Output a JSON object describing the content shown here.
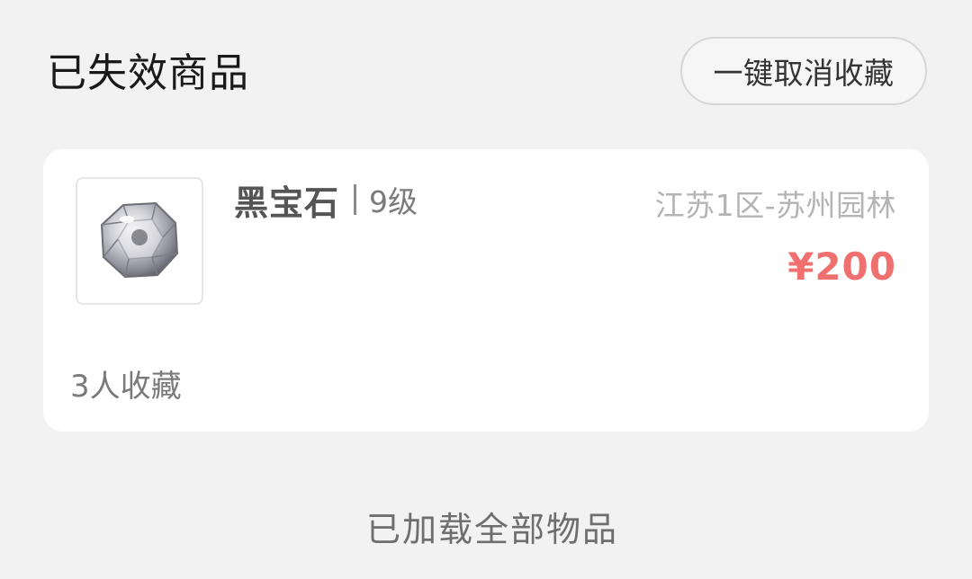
{
  "header": {
    "title": "已失效商品",
    "cancel_all_label": "一键取消收藏"
  },
  "items": [
    {
      "name": "黑宝石",
      "level": "9级",
      "server": "江苏1区-苏州园林",
      "price": "¥200",
      "favorites": "3人收藏",
      "icon": "black-gem-icon"
    }
  ],
  "footer": {
    "status": "已加载全部物品"
  },
  "colors": {
    "background": "#f2f2f2",
    "card": "#ffffff",
    "price": "#f07070",
    "server": "#b4b4b4"
  }
}
